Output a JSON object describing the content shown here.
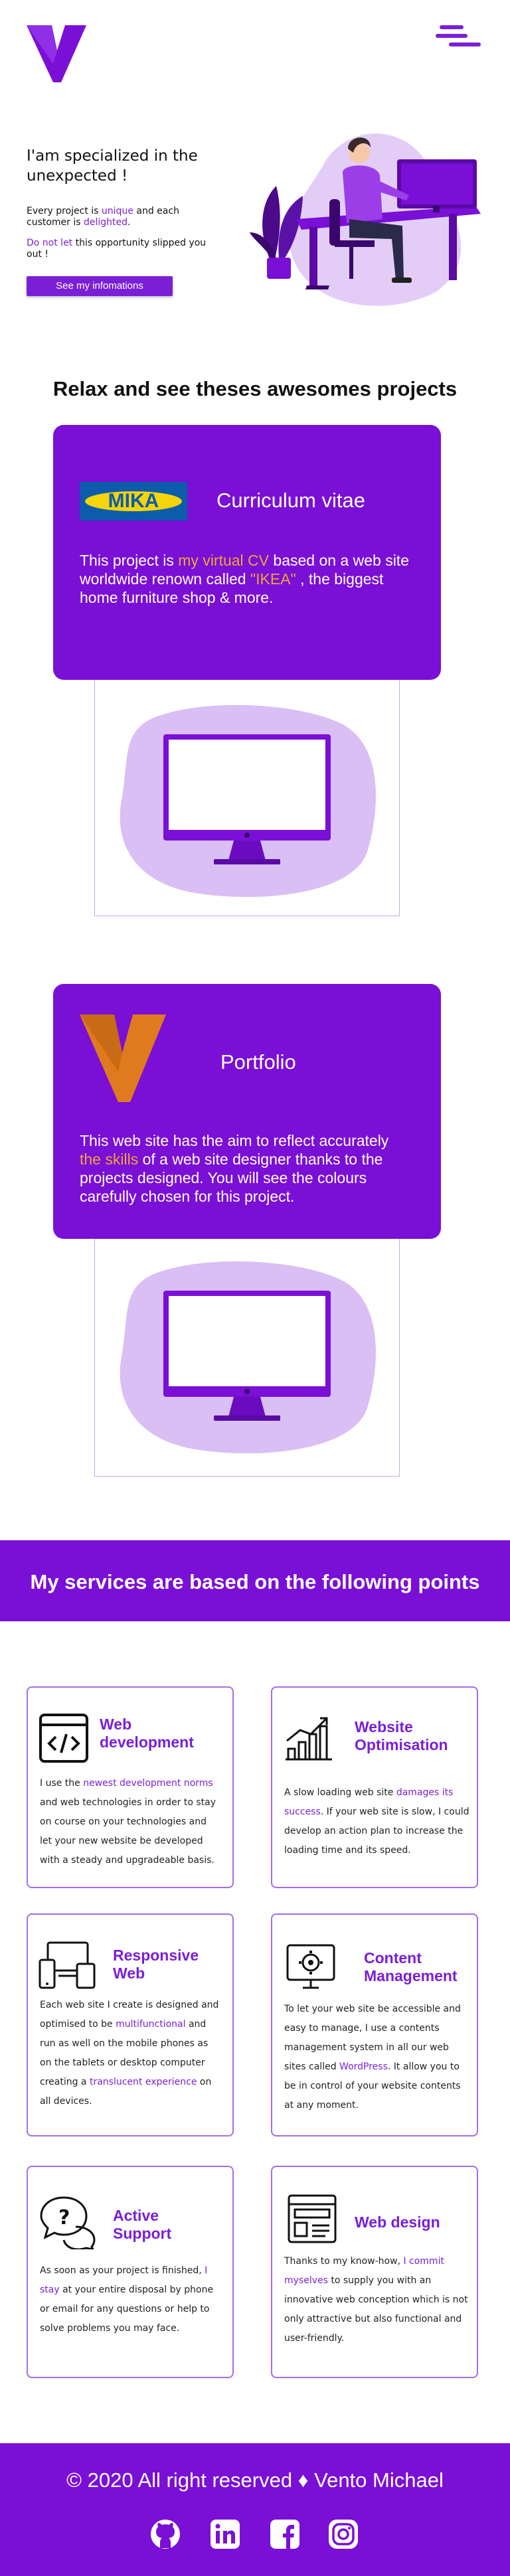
{
  "colors": {
    "primary": "#7a0fd6",
    "accent": "#f0a43a",
    "highlight": "#9b3ee8"
  },
  "header": {
    "logo_icon": "v-logo-icon",
    "menu_icon": "hamburger-menu-icon"
  },
  "hero": {
    "title": "I'am specialized in the unexpected !",
    "p1_a": "Every project is ",
    "p1_b": "unique",
    "p1_c": " and each customer is ",
    "p1_d": "delighted",
    "p1_e": ".",
    "p2_a": "Do not let",
    "p2_b": " this opportunity slipped you out !",
    "button_label": "See my infomations",
    "illustration_icon": "person-at-desk-illustration"
  },
  "projects": {
    "title": "Relax and see theses awesomes projects",
    "cv": {
      "logo_text": "MIKA",
      "title": "Curriculum vitae",
      "t1": "This project is ",
      "t2": "my virtual CV",
      "t3": " based on a web site worldwide renown called ",
      "t4": "\"IKEA\"",
      "t5": " , the biggest home furniture shop & more."
    },
    "portfolio": {
      "title": "Portfolio",
      "t1": "This web site has the aim to reflect accurately ",
      "t2": "the skills",
      "t3": " of a web site designer thanks to the projects designed. You will see the colours carefully chosen for this project."
    }
  },
  "services": {
    "title": "My services are based on the following points",
    "items": [
      {
        "icon": "code-icon",
        "title1": "Web",
        "title2": "development",
        "a": "I use the ",
        "b": "newest development norms",
        "c": " and web technologies in order to stay on course on your technologies and let your new website be developed with a steady and upgradeable basis."
      },
      {
        "icon": "growth-chart-icon",
        "title1": "Website",
        "title2": "Optimisation",
        "a": "A slow loading web site ",
        "b": "damages its success",
        "c": ". If your web site is slow, I could develop an action plan to increase the loading time and its speed."
      },
      {
        "icon": "devices-icon",
        "title1": "Responsive",
        "title2": "Web",
        "a": "Each web site I create is designed and optimised to be ",
        "b": "multifunctional",
        "c": " and run as well on the mobile phones as on the tablets or desktop computer creating a ",
        "d": "translucent experience",
        "e": " on all devices."
      },
      {
        "icon": "gear-monitor-icon",
        "title1": "Content",
        "title2": "Management",
        "a": "To let your web site be accessible and easy to manage, I use a contents management system in all our web sites called ",
        "b": "WordPress",
        "c": ". It allow you to be in control of your website contents at any moment."
      },
      {
        "icon": "question-chat-icon",
        "title1": "Active",
        "title2": "Support",
        "a": "As soon as your project is finished, ",
        "b": "I stay",
        "c": " at your entire disposal by phone or email for any questions or help to solve problems you may face."
      },
      {
        "icon": "layout-icon",
        "title1": "Web design",
        "title2": "",
        "a": "Thanks to my know-how, ",
        "b": "I commit myselves",
        "c": " to supply you with an innovative web conception which is not only attractive but also functional and user-friendly."
      }
    ]
  },
  "footer": {
    "text": "© 2020 All right reserved ♦ Vento Michael",
    "social": [
      "github-icon",
      "linkedin-icon",
      "facebook-icon",
      "instagram-icon"
    ]
  }
}
